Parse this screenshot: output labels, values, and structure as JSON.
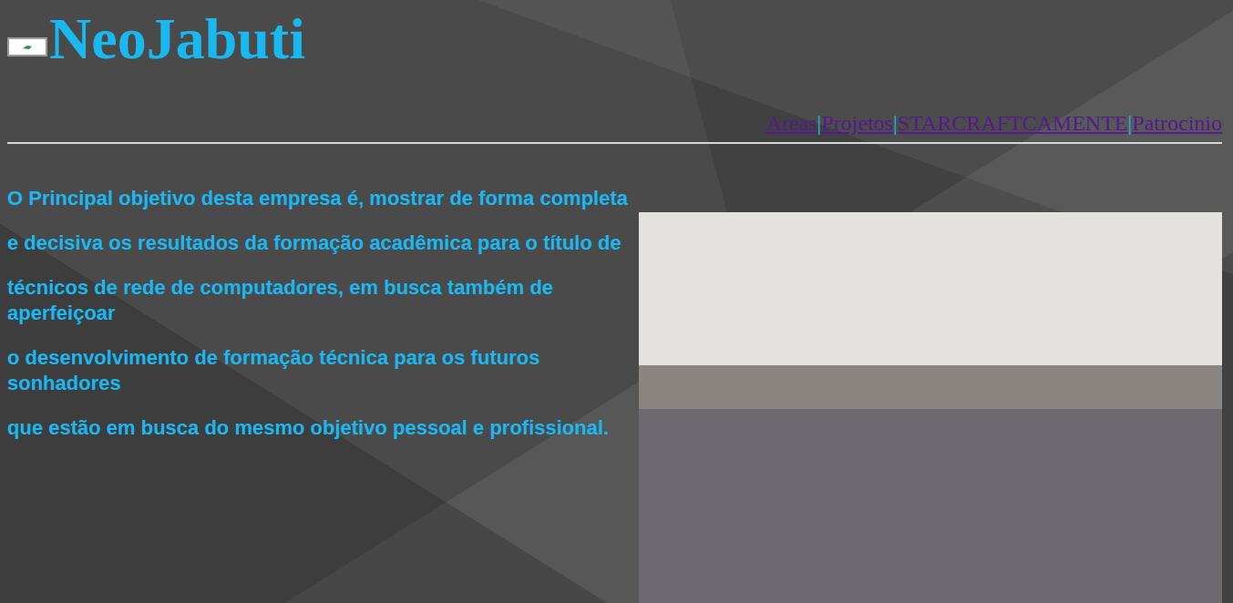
{
  "header": {
    "title": "NeoJabuti"
  },
  "nav": {
    "links": [
      "Areas",
      "Projetos",
      "STARCRAFTCAMENTE",
      "Patrocinio"
    ],
    "separator": "|"
  },
  "intro": {
    "paragraphs": [
      "O Principal objetivo desta empresa é, mostrar de forma completa",
      "e decisiva os resultados da formação acadêmica para o título de",
      "técnicos de rede de computadores, em busca também de aperfeiçoar",
      "o desenvolvimento de formação técnica para os futuros sonhadores",
      "que estão em busca do mesmo objetivo pessoal e profissional."
    ]
  }
}
